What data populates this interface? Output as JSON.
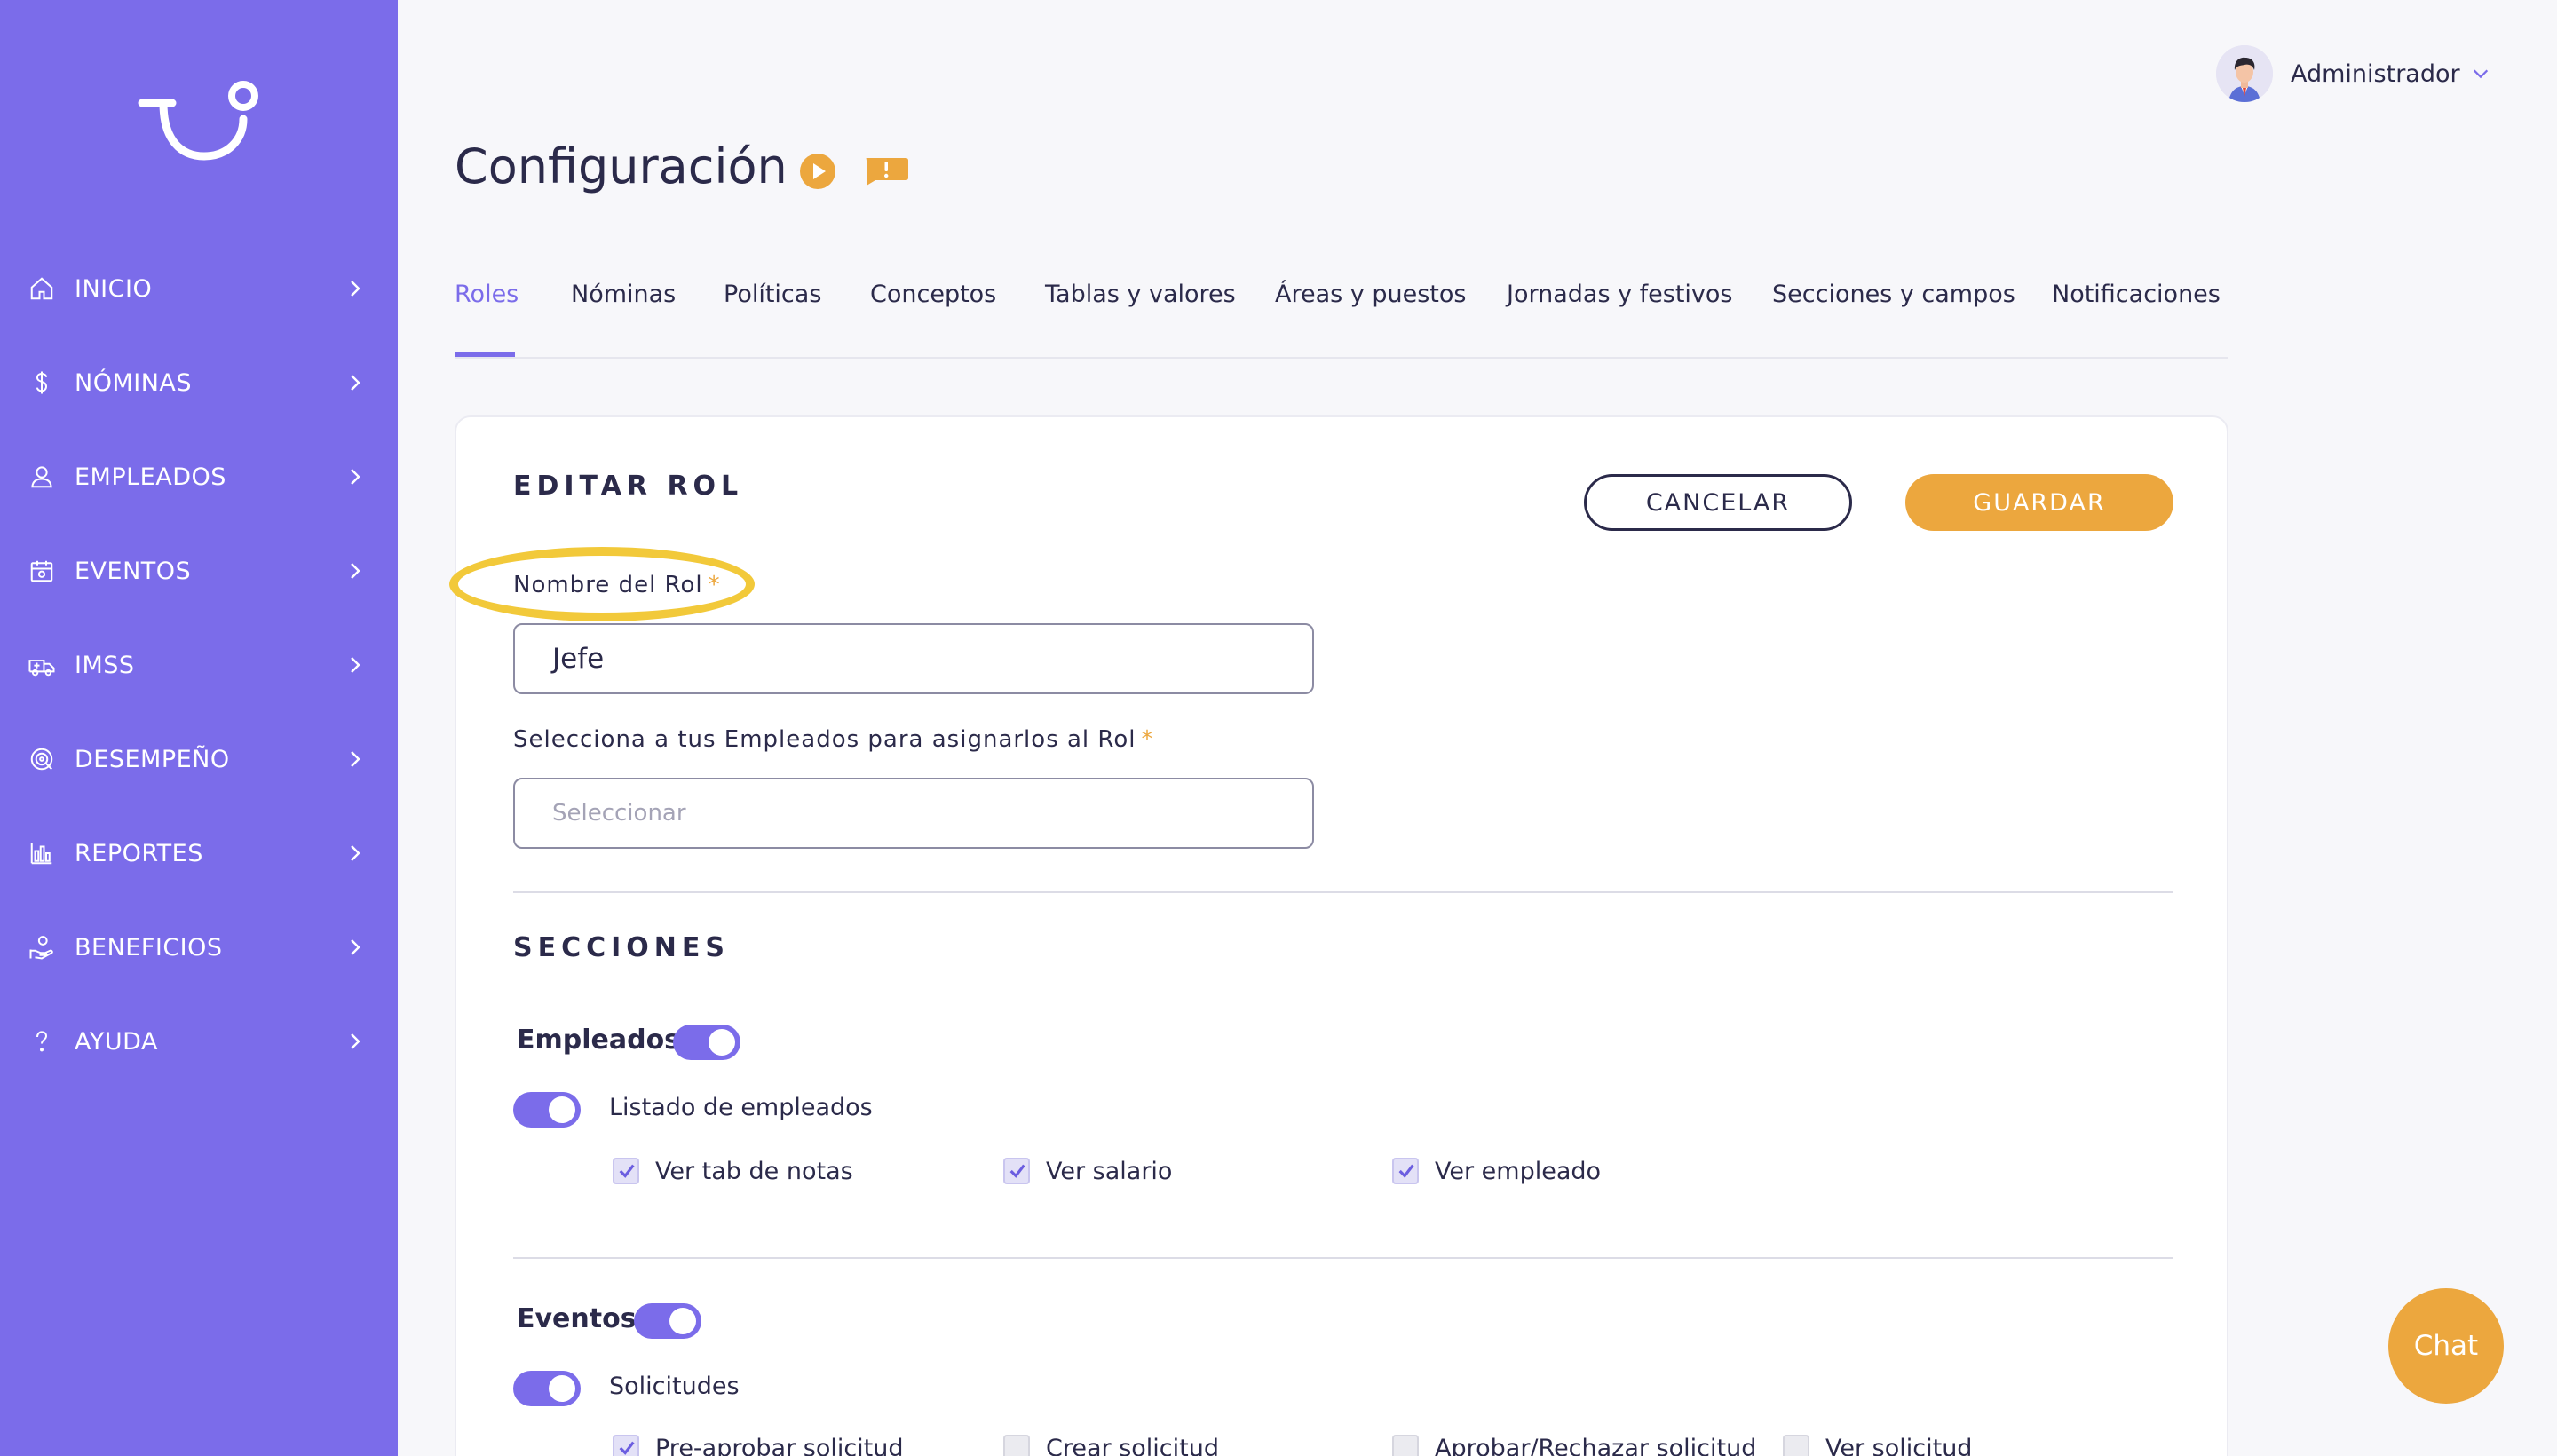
{
  "sidebar": {
    "logo": "logo",
    "items": [
      {
        "label": "INICIO",
        "icon": "home-icon"
      },
      {
        "label": "NÓMINAS",
        "icon": "dollar-icon"
      },
      {
        "label": "EMPLEADOS",
        "icon": "user-icon"
      },
      {
        "label": "EVENTOS",
        "icon": "calendar-icon"
      },
      {
        "label": "IMSS",
        "icon": "ambulance-icon"
      },
      {
        "label": "DESEMPEÑO",
        "icon": "target-icon"
      },
      {
        "label": "REPORTES",
        "icon": "bar-chart-icon"
      },
      {
        "label": "BENEFICIOS",
        "icon": "hand-coin-icon"
      },
      {
        "label": "AYUDA",
        "icon": "question-icon"
      }
    ]
  },
  "header": {
    "user_name": "Administrador",
    "page_title": "Configuración"
  },
  "tabs": [
    {
      "label": "Roles",
      "active": true
    },
    {
      "label": "Nóminas"
    },
    {
      "label": "Políticas"
    },
    {
      "label": "Conceptos"
    },
    {
      "label": "Tablas y valores"
    },
    {
      "label": "Áreas y puestos"
    },
    {
      "label": "Jornadas y festivos"
    },
    {
      "label": "Secciones y campos"
    },
    {
      "label": "Notificaciones"
    }
  ],
  "form": {
    "heading": "EDITAR ROL",
    "cancel_label": "CANCELAR",
    "save_label": "GUARDAR",
    "name_label": "Nombre del Rol",
    "required_mark": "*",
    "name_value": "Jefe",
    "employees_label": "Selecciona a tus Empleados para asignarlos al Rol",
    "employees_placeholder": "Seleccionar"
  },
  "sections": {
    "heading": "SECCIONES",
    "empleados": {
      "title": "Empleados",
      "enabled": true,
      "listado": {
        "label": "Listado de empleados",
        "enabled": true
      },
      "permissions": [
        {
          "label": "Ver tab de notas",
          "checked": true
        },
        {
          "label": "Ver salario",
          "checked": true
        },
        {
          "label": "Ver empleado",
          "checked": true
        }
      ]
    },
    "eventos": {
      "title": "Eventos",
      "enabled": true,
      "solicitudes": {
        "label": "Solicitudes",
        "enabled": true
      },
      "permissions": [
        {
          "label": "Pre-aprobar solicitud",
          "checked": true
        },
        {
          "label": "Crear solicitud",
          "checked": false
        },
        {
          "label": "Aprobar/Rechazar solicitud",
          "checked": false
        },
        {
          "label": "Ver solicitud",
          "checked": false
        }
      ]
    }
  },
  "chat_label": "Chat",
  "colors": {
    "sidebar": "#7b6cea",
    "accent": "#eca73e",
    "primary": "#7b6cea",
    "text": "#2b2a4a"
  }
}
